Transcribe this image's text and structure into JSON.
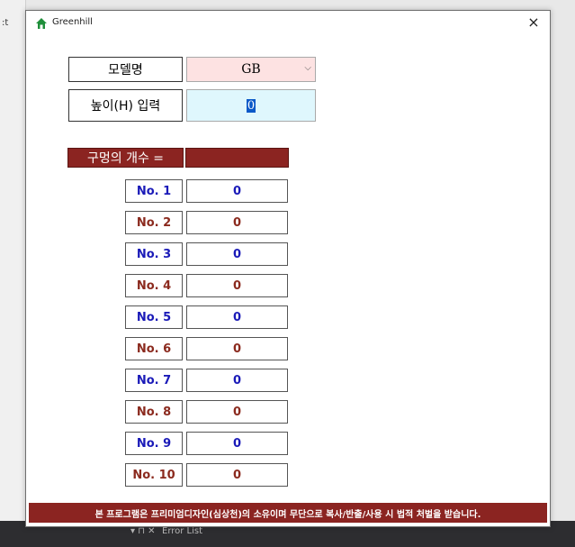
{
  "window": {
    "title": "Greenhill",
    "close_glyph": "×"
  },
  "model": {
    "label": "모델명",
    "value": "GB"
  },
  "height": {
    "label": "높이(H) 입력",
    "value": "0"
  },
  "holes": {
    "label": "구멍의 개수 =",
    "value": ""
  },
  "items": [
    {
      "label": "No. 1",
      "value": "0",
      "color": "blue"
    },
    {
      "label": "No. 2",
      "value": "0",
      "color": "red"
    },
    {
      "label": "No. 3",
      "value": "0",
      "color": "blue"
    },
    {
      "label": "No. 4",
      "value": "0",
      "color": "red"
    },
    {
      "label": "No. 5",
      "value": "0",
      "color": "blue"
    },
    {
      "label": "No. 6",
      "value": "0",
      "color": "red"
    },
    {
      "label": "No. 7",
      "value": "0",
      "color": "blue"
    },
    {
      "label": "No. 8",
      "value": "0",
      "color": "red"
    },
    {
      "label": "No. 9",
      "value": "0",
      "color": "blue"
    },
    {
      "label": "No. 10",
      "value": "0",
      "color": "red"
    }
  ],
  "notice": "본 프로그램은 프리미엄디자인(심상천)의 소유이며 무단으로 복사/반출/사용 시 법적 처벌을 받습니다.",
  "background_ide": {
    "error_list_label": "Error List",
    "pin_glyph": "▾ ⊓ ✕"
  },
  "colors": {
    "accent_dark_red": "#8b2421",
    "blue_label": "#1a1ab8",
    "red_label": "#8b2a1e",
    "select_bg": "#fde2e2",
    "input_bg": "#dff7fd"
  },
  "icons": {
    "app": "greenhill-house-icon",
    "close": "close-icon",
    "dropdown": "chevron-down-icon"
  }
}
